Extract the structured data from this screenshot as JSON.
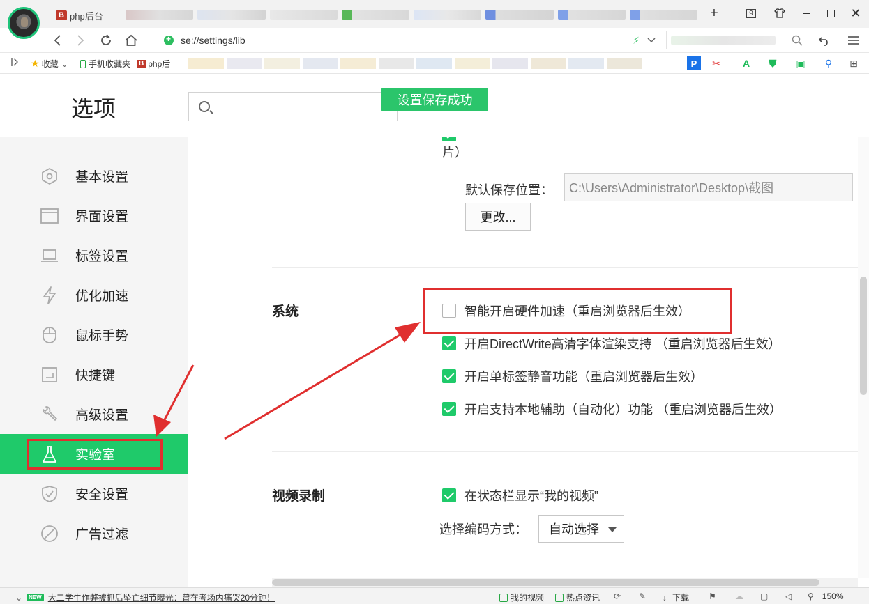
{
  "browser": {
    "tab_label": "php后台",
    "tab_favicon": "B",
    "address": "se://settings/lib",
    "bookmarks": {
      "favorites": "收藏",
      "mobile_favorites": "手机收藏夹",
      "php": "php后"
    }
  },
  "page": {
    "title": "选项",
    "search_placeholder": "",
    "toast": "设置保存成功"
  },
  "sidebar": {
    "items": [
      {
        "label": "基本设置",
        "icon": "hexagon-icon"
      },
      {
        "label": "界面设置",
        "icon": "window-icon"
      },
      {
        "label": "标签设置",
        "icon": "laptop-icon"
      },
      {
        "label": "优化加速",
        "icon": "lightning-icon"
      },
      {
        "label": "鼠标手势",
        "icon": "mouse-icon"
      },
      {
        "label": "快捷键",
        "icon": "keyboard-icon"
      },
      {
        "label": "高级设置",
        "icon": "wrench-icon"
      },
      {
        "label": "实验室",
        "icon": "flask-icon"
      },
      {
        "label": "安全设置",
        "icon": "shield-icon"
      },
      {
        "label": "广告过滤",
        "icon": "block-icon"
      }
    ],
    "active_index": 7
  },
  "screenshot": {
    "partial_text": "片）",
    "save_location_label": "默认保存位置：",
    "save_location_value": "C:\\Users\\Administrator\\Desktop\\截图",
    "change_button": "更改..."
  },
  "system": {
    "title": "系统",
    "options": [
      {
        "label": "智能开启硬件加速（重启浏览器后生效）",
        "checked": false
      },
      {
        "label": "开启DirectWrite高清字体渲染支持 （重启浏览器后生效）",
        "checked": true
      },
      {
        "label": "开启单标签静音功能（重启浏览器后生效）",
        "checked": true
      },
      {
        "label": "开启支持本地辅助（自动化）功能 （重启浏览器后生效）",
        "checked": true
      }
    ]
  },
  "video": {
    "title": "视频录制",
    "status_bar_option": {
      "label": "在状态栏显示“我的视频”",
      "checked": true
    },
    "encoding_label": "选择编码方式：",
    "encoding_value": "自动选择"
  },
  "statusbar": {
    "news_badge": "NEW",
    "news_text": "大二学生作弊被抓后坠亡细节曝光：曾在考场内痛哭20分钟！",
    "my_video": "我的视频",
    "hot_news": "热点资讯",
    "download": "下载",
    "zoom": "150%"
  },
  "colors": {
    "accent": "#1fca6a",
    "toast": "#2bc56b",
    "annotation": "#e02f2f"
  }
}
